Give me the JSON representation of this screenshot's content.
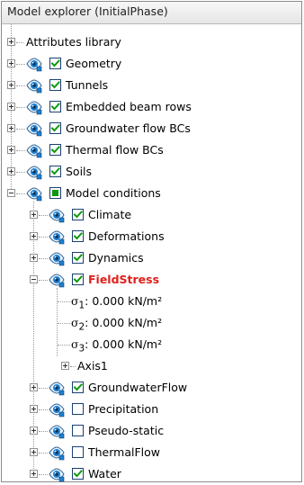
{
  "panel": {
    "title": "Model explorer (InitialPhase)"
  },
  "tree": {
    "attributes_library": "Attributes library",
    "geometry": "Geometry",
    "tunnels": "Tunnels",
    "embedded_beam_rows": "Embedded beam rows",
    "groundwater_flow_bcs": "Groundwater flow BCs",
    "thermal_flow_bcs": "Thermal flow BCs",
    "soils": "Soils",
    "model_conditions": "Model conditions",
    "climate": "Climate",
    "deformations": "Deformations",
    "dynamics": "Dynamics",
    "fieldstress": "FieldStress",
    "sigma1_symbol": "σ",
    "sigma1_sub": "1",
    "sigma1_value": ": 0.000 kN/m²",
    "sigma2_symbol": "σ",
    "sigma2_sub": "2",
    "sigma2_value": ": 0.000 kN/m²",
    "sigma3_symbol": "σ",
    "sigma3_sub": "3",
    "sigma3_value": ": 0.000 kN/m²",
    "axis1": "Axis1",
    "groundwaterflow": "GroundwaterFlow",
    "precipitation": "Precipitation",
    "pseudo_static": "Pseudo-static",
    "thermalflow": "ThermalFlow",
    "water": "Water"
  },
  "icons": {
    "visibility": "eye-icon",
    "expand": "plus-box-icon",
    "collapse": "minus-box-icon"
  },
  "colors": {
    "check_green": "#0c9a0c",
    "highlight_red": "#e0201c",
    "eye_blue": "#1e7fd0"
  },
  "states": {
    "geometry_checked": true,
    "tunnels_checked": true,
    "embedded_beam_rows_checked": true,
    "groundwater_flow_bcs_checked": true,
    "thermal_flow_bcs_checked": true,
    "soils_checked": true,
    "model_conditions_checked": "partial",
    "climate_checked": true,
    "deformations_checked": true,
    "dynamics_checked": true,
    "fieldstress_checked": true,
    "groundwaterflow_checked": true,
    "precipitation_checked": false,
    "pseudo_static_checked": false,
    "thermalflow_checked": false,
    "water_checked": true
  }
}
